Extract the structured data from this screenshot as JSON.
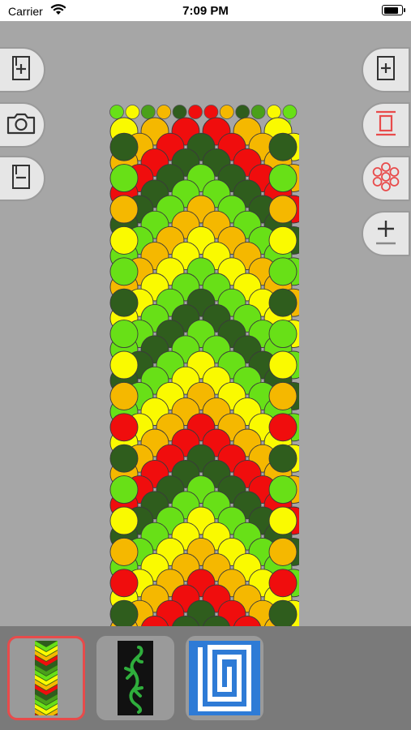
{
  "status_bar": {
    "carrier": "Carrier",
    "time": "7:09 PM",
    "battery_level": 0.85
  },
  "left_toolbar": {
    "buttons": [
      {
        "name": "add-row-above-button",
        "icon": "add-row-icon"
      },
      {
        "name": "camera-button",
        "icon": "camera-icon"
      },
      {
        "name": "remove-row-button",
        "icon": "remove-row-icon"
      }
    ]
  },
  "right_toolbar": {
    "buttons": [
      {
        "name": "add-strand-button",
        "icon": "add-page-icon"
      },
      {
        "name": "frame-button",
        "icon": "frame-icon"
      },
      {
        "name": "knot-pattern-button",
        "icon": "knot-pattern-icon"
      },
      {
        "name": "zoom-button",
        "icon": "plus-minus-icon"
      }
    ],
    "accent": "#e84b4b"
  },
  "pattern": {
    "colors": {
      "G": "#68e017",
      "Y": "#fafa00",
      "K": "#2f5d1d",
      "R": "#f00d0d",
      "O": "#f5b800",
      "M": "#4aa01a"
    },
    "top_strands": [
      "G",
      "Y",
      "M",
      "O",
      "K",
      "R",
      "R",
      "O",
      "K",
      "M",
      "Y",
      "G"
    ]
  },
  "thumbnails": [
    {
      "name": "pattern-thumbnail-chevron",
      "selected": true
    },
    {
      "name": "pattern-thumbnail-lizard",
      "selected": false
    },
    {
      "name": "pattern-thumbnail-meander",
      "selected": false
    }
  ]
}
